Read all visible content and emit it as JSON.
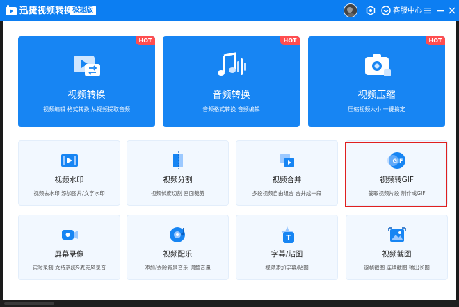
{
  "titlebar": {
    "app_title": "迅捷视频转换器",
    "edition": "极速版",
    "service_label": "客服中心"
  },
  "big_cards": [
    {
      "title": "视频转换",
      "desc": "视频编辑 格式转换 从视频提取音频",
      "badge": "HOT",
      "icon": "video-convert-icon"
    },
    {
      "title": "音频转换",
      "desc": "音频格式转换 音频编辑",
      "badge": "HOT",
      "icon": "audio-convert-icon"
    },
    {
      "title": "视频压缩",
      "desc": "压缩视频大小 一键搞定",
      "badge": "HOT",
      "icon": "video-compress-icon"
    }
  ],
  "small_cards": [
    {
      "title": "视频水印",
      "desc": "视频去水印 添加图片/文字水印",
      "icon": "watermark-icon"
    },
    {
      "title": "视频分割",
      "desc": "视频长度切割 画面裁剪",
      "icon": "split-icon"
    },
    {
      "title": "视频合并",
      "desc": "多段视频自由组合 合并成一段",
      "icon": "merge-icon"
    },
    {
      "title": "视频转GIF",
      "desc": "截取视频片段 制作成GIF",
      "icon": "gif-icon",
      "icon_text": "GIF"
    },
    {
      "title": "屏幕录像",
      "desc": "实时录制 支持系统&麦克风录音",
      "icon": "screen-record-icon"
    },
    {
      "title": "视频配乐",
      "desc": "添加/去除背景音乐 调整音量",
      "icon": "music-icon"
    },
    {
      "title": "字幕/贴图",
      "desc": "视频添加字幕/贴图",
      "icon": "subtitle-icon",
      "icon_text": "T"
    },
    {
      "title": "视频截图",
      "desc": "逐帧截图 连续截图 输出长图",
      "icon": "screenshot-icon"
    }
  ],
  "colors": {
    "brand": "#0c7ef2",
    "card_blue": "#1785f3",
    "hot": "#ff4d4f",
    "highlight": "#e02020"
  }
}
